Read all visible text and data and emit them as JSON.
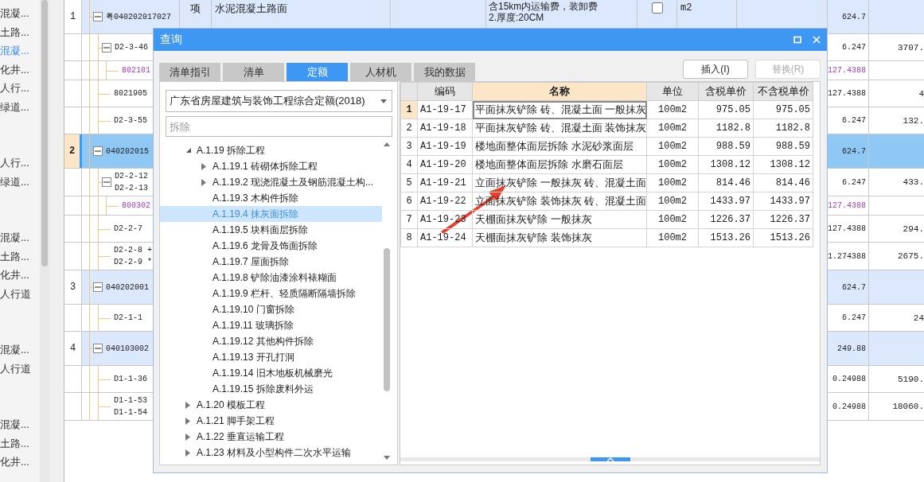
{
  "sidebar": {
    "groups": [
      {
        "items": [
          {
            "label": "混凝...",
            "selected": false
          },
          {
            "label": "土路...",
            "selected": false
          },
          {
            "label": "混凝...",
            "selected": true
          },
          {
            "label": "化井...",
            "selected": false
          },
          {
            "label": "人行...",
            "selected": false
          },
          {
            "label": "绿道...",
            "selected": false
          }
        ]
      },
      {
        "items": [
          {
            "label": "人行...",
            "selected": false
          },
          {
            "label": "绿道...",
            "selected": false
          }
        ]
      },
      {
        "items": [
          {
            "label": "混凝...",
            "selected": false
          },
          {
            "label": "土路...",
            "selected": false
          },
          {
            "label": "化井...",
            "selected": false
          },
          {
            "label": "人行道",
            "selected": false
          }
        ]
      },
      {
        "items": [
          {
            "label": "混凝...",
            "selected": false
          },
          {
            "label": "人行道",
            "selected": false
          }
        ]
      },
      {
        "items": [
          {
            "label": "混凝...",
            "selected": false
          },
          {
            "label": "土路...",
            "selected": false
          },
          {
            "label": "化井...",
            "selected": false
          }
        ]
      }
    ]
  },
  "table": {
    "rows": [
      {
        "seq": "1",
        "kind": "item",
        "code": [
          "粤040202017027"
        ],
        "expanded": true,
        "selected": false,
        "type": "项",
        "name": "水泥混凝土路面",
        "description": [
          "含15km内运输费，装卸费",
          "2.厚度:20CM"
        ],
        "checked": false,
        "unit": "m2",
        "quantity": "624.7",
        "children": [
          {
            "kind": "quota",
            "code": [
              "D2-3-46"
            ],
            "expanded": true,
            "selected": false,
            "quantity": "6.247",
            "column_11": "3707.",
            "children": [
              {
                "kind": "material",
                "code": [
                  "802101"
                ],
                "selected": false,
                "quantity": "127.4388"
              }
            ]
          },
          {
            "kind": "quota",
            "code": [
              "8021905"
            ],
            "selected": false,
            "quantity": "127.4388",
            "column_11": "4"
          },
          {
            "kind": "quota",
            "code": [
              "D2-3-55"
            ],
            "selected": false,
            "quantity": "6.247",
            "column_11": "132."
          }
        ]
      },
      {
        "seq": "2",
        "kind": "item",
        "code": [
          "040202015"
        ],
        "expanded": true,
        "selected": true,
        "quantity": "624.7",
        "children": [
          {
            "kind": "quota",
            "code": [
              "D2-2-12",
              "D2-2-13"
            ],
            "expanded": true,
            "selected": false,
            "quantity": "6.247",
            "column_11": "433.",
            "children": [
              {
                "kind": "material",
                "code": [
                  "800302"
                ],
                "selected": false,
                "quantity": "127.4388"
              }
            ]
          },
          {
            "kind": "quota",
            "code": [
              "D2-2-7"
            ],
            "selected": false,
            "quantity": "127.4388",
            "column_11": "294."
          },
          {
            "kind": "quota",
            "code": [
              "D2-2-8 +",
              "D2-2-9 *"
            ],
            "selected": false,
            "quantity": "1.274388",
            "column_11": "2675."
          }
        ]
      },
      {
        "seq": "3",
        "kind": "item",
        "code": [
          "040202001"
        ],
        "expanded": true,
        "selected": false,
        "quantity": "624.7",
        "children": [
          {
            "kind": "quota",
            "code": [
              "D2-1-1"
            ],
            "selected": false,
            "quantity": "6.247",
            "column_11": "24"
          }
        ]
      },
      {
        "seq": "4",
        "kind": "item",
        "code": [
          "040103002"
        ],
        "expanded": true,
        "selected": false,
        "quantity": "249.88",
        "children": [
          {
            "kind": "quota",
            "code": [
              "D1-1-36"
            ],
            "selected": false,
            "quantity": "0.24988",
            "column_11": "5190."
          },
          {
            "kind": "quota",
            "code": [
              "D1-1-53",
              "D1-1-54"
            ],
            "selected": false,
            "quantity": "0.24988",
            "column_11": "18060."
          }
        ]
      }
    ]
  },
  "dialog": {
    "title": "查询",
    "tabs": [
      {
        "label": "清单指引",
        "selected": false
      },
      {
        "label": "清单",
        "selected": false
      },
      {
        "label": "定额",
        "selected": true
      },
      {
        "label": "人材机",
        "selected": false
      },
      {
        "label": "我的数据",
        "selected": false
      }
    ],
    "buttons": [
      {
        "label": "插入(I)",
        "disabled": false
      },
      {
        "label": "替换(R)",
        "disabled": true
      }
    ],
    "library": {
      "value": "广东省房屋建筑与装饰工程综合定额(2018)"
    },
    "search": {
      "placeholder": "拆除"
    },
    "tree": [
      {
        "label": "A.1.19 拆除工程",
        "expanded": true,
        "selected": false,
        "children": [
          {
            "label": "A.1.19.1 砖砌体拆除工程",
            "expanded": false,
            "selected": false
          },
          {
            "label": "A.1.19.2 现浇混凝土及钢筋混凝土构...",
            "expanded": false,
            "selected": false
          },
          {
            "label": "A.1.19.3 木构件拆除",
            "selected": false
          },
          {
            "label": "A.1.19.4 抹灰面拆除",
            "selected": true
          },
          {
            "label": "A.1.19.5 块料面层拆除",
            "selected": false
          },
          {
            "label": "A.1.19.6 龙骨及饰面拆除",
            "selected": false
          },
          {
            "label": "A.1.19.7 屋面拆除",
            "selected": false
          },
          {
            "label": "A.1.19.8 铲除油漆涂料裱糊面",
            "selected": false
          },
          {
            "label": "A.1.19.9 栏杆、轻质隔断隔墙拆除",
            "selected": false
          },
          {
            "label": "A.1.19.10 门窗拆除",
            "selected": false
          },
          {
            "label": "A.1.19.11 玻璃拆除",
            "selected": false
          },
          {
            "label": "A.1.19.12 其他构件拆除",
            "selected": false
          },
          {
            "label": "A.1.19.13 开孔打洞",
            "selected": false
          },
          {
            "label": "A.1.19.14 旧木地板机械磨光",
            "selected": false
          },
          {
            "label": "A.1.19.15 拆除废料外运",
            "selected": false
          }
        ]
      },
      {
        "label": "A.1.20 模板工程",
        "expanded": false,
        "selected": false
      },
      {
        "label": "A.1.21 脚手架工程",
        "expanded": false,
        "selected": false
      },
      {
        "label": "A.1.22 垂直运输工程",
        "expanded": false,
        "selected": false
      },
      {
        "label": "A.1.23 材料及小型构件二次水平运输",
        "expanded": false,
        "selected": false
      }
    ],
    "results": {
      "columns": [
        {
          "label": "编码",
          "selected": false
        },
        {
          "label": "名称",
          "selected": true
        },
        {
          "label": "单位",
          "selected": false
        },
        {
          "label": "含税单价",
          "selected": false
        },
        {
          "label": "不含税单价",
          "selected": false
        }
      ],
      "rows": [
        {
          "index": "1",
          "code": "A1-19-17",
          "name": "平面抹灰铲除 砖、混凝土面 一般抹灰",
          "unit": "100m2",
          "price_with_tax": "975.05",
          "price_without_tax": "975.05",
          "selected": true
        },
        {
          "index": "2",
          "code": "A1-19-18",
          "name": "平面抹灰铲除 砖、混凝土面 装饰抹灰",
          "unit": "100m2",
          "price_with_tax": "1182.8",
          "price_without_tax": "1182.8",
          "selected": false
        },
        {
          "index": "3",
          "code": "A1-19-19",
          "name": "楼地面整体面层拆除 水泥砂浆面层",
          "unit": "100m2",
          "price_with_tax": "988.59",
          "price_without_tax": "988.59",
          "selected": false
        },
        {
          "index": "4",
          "code": "A1-19-20",
          "name": "楼地面整体面层拆除 水磨石面层",
          "unit": "100m2",
          "price_with_tax": "1308.12",
          "price_without_tax": "1308.12",
          "selected": false
        },
        {
          "index": "5",
          "code": "A1-19-21",
          "name": "立面抹灰铲除 一般抹灰 砖、混凝土面",
          "unit": "100m2",
          "price_with_tax": "814.46",
          "price_without_tax": "814.46",
          "selected": false
        },
        {
          "index": "6",
          "code": "A1-19-22",
          "name": "立面抹灰铲除 装饰抹灰 砖、混凝土面",
          "unit": "100m2",
          "price_with_tax": "1433.97",
          "price_without_tax": "1433.97",
          "selected": false
        },
        {
          "index": "7",
          "code": "A1-19-23",
          "name": "天棚面抹灰铲除 一般抹灰",
          "unit": "100m2",
          "price_with_tax": "1226.37",
          "price_without_tax": "1226.37",
          "selected": false
        },
        {
          "index": "8",
          "code": "A1-19-24",
          "name": "天棚面抹灰铲除 装饰抹灰",
          "unit": "100m2",
          "price_with_tax": "1513.26",
          "price_without_tax": "1513.26",
          "selected": false
        }
      ]
    }
  }
}
